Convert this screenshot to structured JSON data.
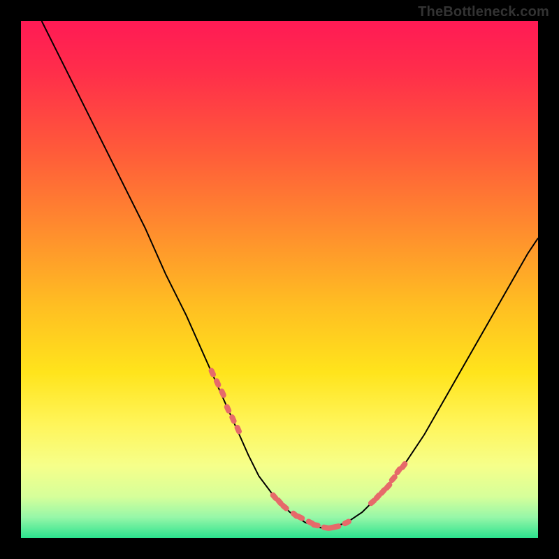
{
  "watermark": "TheBottleneck.com",
  "colors": {
    "background": "#000000",
    "watermark_text": "#333333",
    "gradient_stops": [
      {
        "offset": 0.0,
        "color": "#ff1a55"
      },
      {
        "offset": 0.1,
        "color": "#ff2e4a"
      },
      {
        "offset": 0.25,
        "color": "#ff5a3a"
      },
      {
        "offset": 0.4,
        "color": "#ff8b2e"
      },
      {
        "offset": 0.55,
        "color": "#ffbe22"
      },
      {
        "offset": 0.68,
        "color": "#ffe41c"
      },
      {
        "offset": 0.78,
        "color": "#fff55a"
      },
      {
        "offset": 0.86,
        "color": "#f6ff8a"
      },
      {
        "offset": 0.92,
        "color": "#d6ff9a"
      },
      {
        "offset": 0.96,
        "color": "#96f7a8"
      },
      {
        "offset": 1.0,
        "color": "#2be28e"
      }
    ],
    "curve_stroke": "#000000",
    "marker_fill": "#e66a6a"
  },
  "chart_data": {
    "type": "line",
    "title": "",
    "xlabel": "",
    "ylabel": "",
    "xlim": [
      0,
      100
    ],
    "ylim": [
      0,
      100
    ],
    "grid": false,
    "legend": false,
    "series": [
      {
        "name": "curve",
        "x": [
          4,
          8,
          12,
          16,
          20,
          24,
          28,
          32,
          36,
          40,
          44,
          46,
          49,
          52,
          55,
          58,
          60,
          63,
          66,
          70,
          74,
          78,
          82,
          86,
          90,
          94,
          98,
          100
        ],
        "y": [
          100,
          92,
          84,
          76,
          68,
          60,
          51,
          43,
          34,
          25,
          16,
          12,
          8,
          5,
          3,
          2,
          2,
          3,
          5,
          9,
          14,
          20,
          27,
          34,
          41,
          48,
          55,
          58
        ]
      }
    ],
    "markers": {
      "name": "highlight-segments",
      "x": [
        37,
        38,
        39,
        40,
        41,
        42,
        49,
        50,
        51,
        53,
        54,
        56,
        57,
        59,
        60,
        61,
        63,
        68,
        69,
        70,
        71,
        72,
        73,
        74
      ],
      "y": [
        32,
        30,
        28,
        25,
        23,
        21,
        8,
        7,
        6,
        4.5,
        4,
        3,
        2.5,
        2,
        2,
        2.2,
        3,
        7,
        8,
        9,
        10,
        11.5,
        13,
        14
      ]
    }
  }
}
